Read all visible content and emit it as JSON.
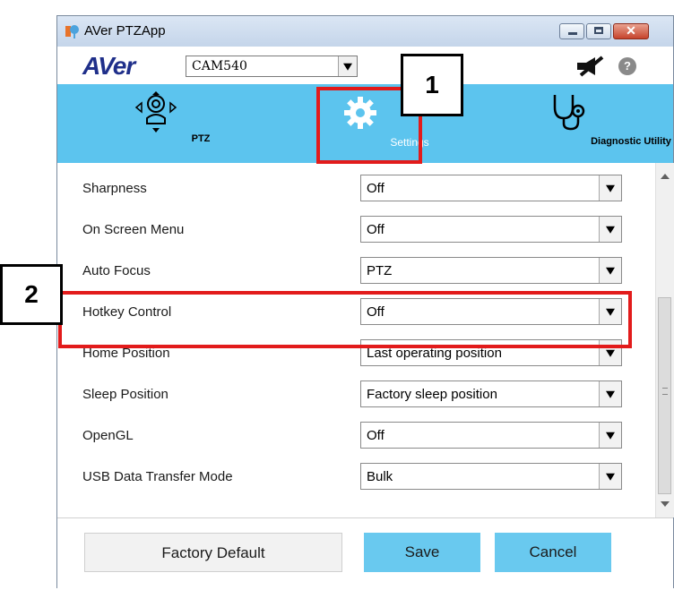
{
  "window": {
    "title": "AVer PTZApp",
    "controls": {
      "minimize": "minimize",
      "maximize": "maximize",
      "close": "✕"
    }
  },
  "toolbar": {
    "logo": "AVer",
    "camera_select": {
      "value": "CAM540"
    },
    "help": "?"
  },
  "nav": {
    "items": [
      {
        "label": "PTZ",
        "icon": "ptz-camera-icon"
      },
      {
        "label": "Settings",
        "icon": "gear-icon",
        "active": true
      },
      {
        "label": "Diagnostic Utility",
        "icon": "stethoscope-icon"
      }
    ]
  },
  "settings": [
    {
      "label": "Sharpness",
      "value": "Off"
    },
    {
      "label": "On Screen Menu",
      "value": "Off"
    },
    {
      "label": "Auto Focus",
      "value": "PTZ"
    },
    {
      "label": "Hotkey Control",
      "value": "Off"
    },
    {
      "label": "Home Position",
      "value": "Last operating position"
    },
    {
      "label": "Sleep Position",
      "value": "Factory sleep position"
    },
    {
      "label": "OpenGL",
      "value": "Off"
    },
    {
      "label": "USB Data Transfer Mode",
      "value": "Bulk"
    }
  ],
  "footer": {
    "factory_default": "Factory Default",
    "save": "Save",
    "cancel": "Cancel"
  },
  "annotations": {
    "badge1": "1",
    "badge2": "2"
  },
  "colors": {
    "nav_blue": "#5cc4ee",
    "button_blue": "#69c9ef",
    "annotation_red": "#e21b1b",
    "logo_blue": "#1f2f8a"
  }
}
